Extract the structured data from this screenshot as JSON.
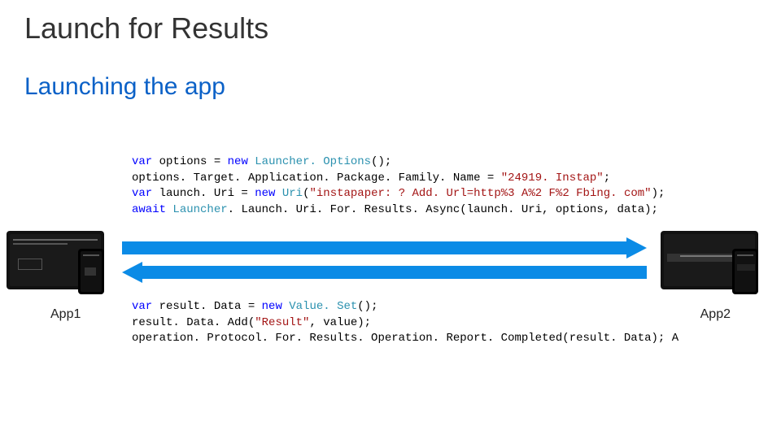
{
  "title": "Launch for Results",
  "subtitle": "Launching the app",
  "labels": {
    "app1": "App1",
    "app2": "App2"
  },
  "code_top": {
    "l1a": "var",
    "l1b": " options = ",
    "l1c": "new",
    "l1d": " Launcher. Options",
    "l1e": "();",
    "l2a": "options. Target. Application. Package. Family. Name = ",
    "l2b": "\"24919. Instap\"",
    "l2c": ";",
    "l3a": "var",
    "l3b": " launch. Uri = ",
    "l3c": "new",
    "l3d": " Uri",
    "l3e": "(",
    "l3f": "\"instapaper: ? Add. Url=http%3 A%2 F%2 Fbing. com\"",
    "l3g": ");",
    "l4a": "await",
    "l4b": " Launcher",
    "l4c": ". Launch. Uri. For. Results. Async(launch. Uri, options, data);"
  },
  "code_bottom": {
    "l1a": "var",
    "l1b": " result. Data = ",
    "l1c": "new",
    "l1d": " Value. Set",
    "l1e": "();",
    "l2a": "result. Data. Add(",
    "l2b": "\"Result\"",
    "l2c": ", value);",
    "l3a": "operation. Protocol. For. Results. Operation. Report. Completed(result. Data); A"
  }
}
